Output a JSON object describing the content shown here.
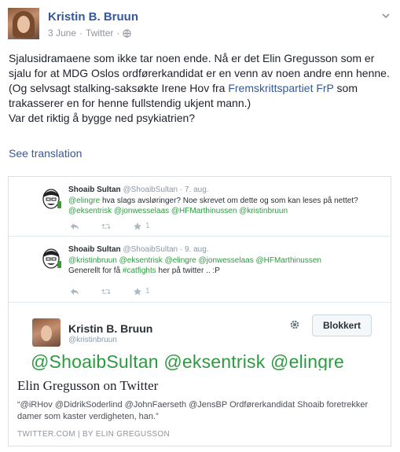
{
  "post": {
    "author": "Kristin B. Bruun",
    "date": "3 June",
    "separator": "·",
    "source": "Twitter",
    "separator2": "·",
    "text_lines": [
      "Sjalusidramaene som ikke tar noen ende. Nå er det Elin Gregusson som er sjalu for at MDG Oslos ordførerkandidat er en venn av noen andre enn henne."
    ],
    "text_line2_pre": "(Og selvsagt stalking-saksøkte Irene Hov fra ",
    "text_line2_link": "Fremskrittspartiet FrP",
    "text_line2_post": " som trakasserer en for henne fullstendig ukjent mann.)",
    "text_line3": "Var det riktig å bygge ned psykiatrien?",
    "see_translation": "See translation"
  },
  "card": {
    "tweets": [
      {
        "name": "Shoaib Sultan",
        "handle": "@ShoaibSultan · 7. aug.",
        "mention_prefix": "@elingre",
        "text1": " hva slags avsløringer? Noe skrevet om dette og som kan leses på nettet? ",
        "mentions_tail": "@eksentrisk @jonwesselaas @HFMarthinussen @kristinbruun",
        "fav_count": "1"
      },
      {
        "name": "Shoaib Sultan",
        "handle": "@ShoaibSultan · 9. aug.",
        "mentions_line": "@kristinbruun @eksentrisk @elingre @jonwesselaas @HFMarthinussen",
        "text_pre": "Generellt for få ",
        "hashtag": "#catfights",
        "text_post": " her på twitter .. :P",
        "fav_count": "1"
      }
    ],
    "profile": {
      "name": "Kristin B. Bruun",
      "handle": "@kristinbruun",
      "block_label": "Blokkert",
      "mentions": "@ShoaibSultan @eksentrisk @elingre"
    },
    "title": "Elin Gregusson on Twitter",
    "description": "“@iRHov @DidrikSoderlind @JohnFaerseth @JensBP Ordførerkandidat Shoaib foretrekker damer som kaster verdigheten, han.”",
    "source_domain": "TWITTER.COM",
    "source_sep": "|",
    "source_by": "BY ELIN GREGUSSON"
  },
  "colors": {
    "link": "#365899",
    "mention_green": "#2b9b3f",
    "meta_gray": "#90949c"
  },
  "icons": [
    "globe-icon",
    "chevron-down-icon",
    "reply-icon",
    "retweet-icon",
    "star-icon",
    "gear-icon"
  ]
}
